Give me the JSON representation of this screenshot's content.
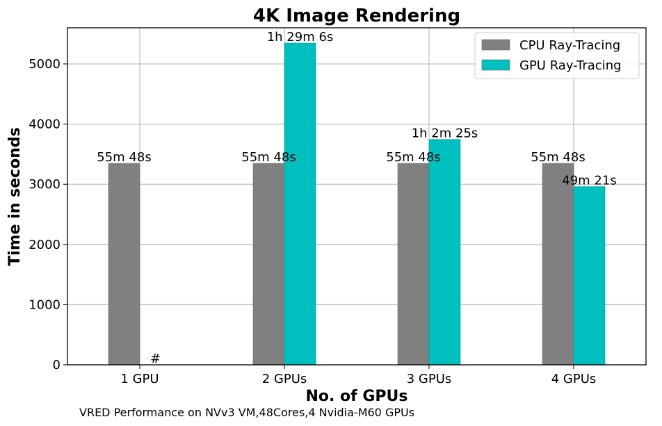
{
  "chart_data": {
    "type": "bar",
    "title": "4K Image Rendering",
    "xlabel": "No. of GPUs",
    "ylabel": "Time in seconds",
    "footnote": "VRED Performance on NVv3 VM,48Cores,4 Nvidia-M60 GPUs",
    "categories": [
      "1 GPU",
      "2 GPUs",
      "3 GPUs",
      "4 GPUs"
    ],
    "ylim": [
      0,
      5600
    ],
    "yticks": [
      0,
      1000,
      2000,
      3000,
      4000,
      5000
    ],
    "grid": true,
    "legend_position": "top-right",
    "series": [
      {
        "name": "CPU Ray-Tracing",
        "color": "#808080",
        "values": [
          3348,
          3348,
          3348,
          3348
        ],
        "labels": [
          "55m 48s",
          "55m 48s",
          "55m 48s",
          "55m 48s"
        ]
      },
      {
        "name": "GPU Ray-Tracing",
        "color": "#00bfbf",
        "values": [
          0,
          5346,
          3745,
          2961
        ],
        "labels": [
          "#",
          "1h 29m 6s",
          "1h 2m 25s",
          "49m 21s"
        ]
      }
    ]
  }
}
